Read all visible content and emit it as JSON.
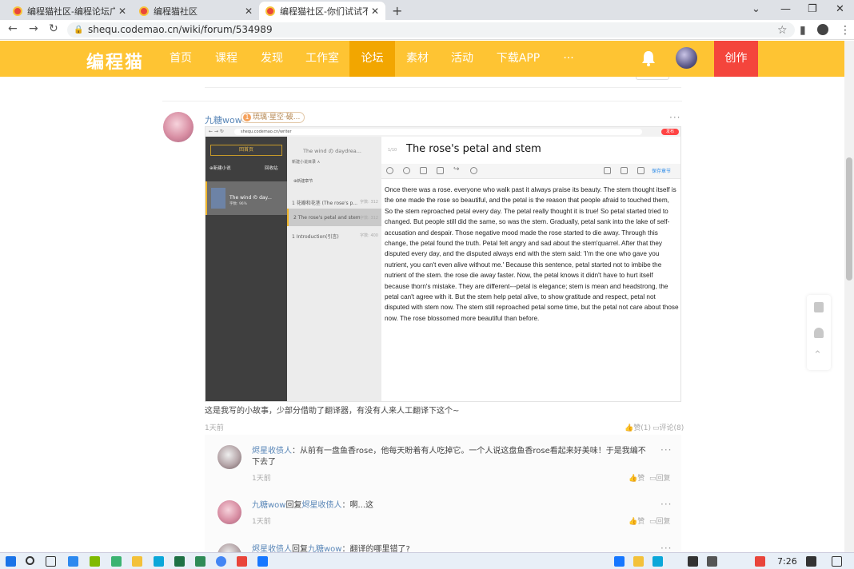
{
  "browser": {
    "tabs": [
      {
        "title": "编程猫社区-编程论坛广场-编程",
        "active": false
      },
      {
        "title": "编程猫社区",
        "active": false
      },
      {
        "title": "编程猫社区-你们试试不用任何",
        "active": true
      }
    ],
    "url": "shequ.codemao.cn/wiki/forum/534989"
  },
  "nav": {
    "logo": "编程猫",
    "items": [
      "首页",
      "课程",
      "发现",
      "工作室",
      "论坛",
      "素材",
      "活动",
      "下载APP",
      "···"
    ],
    "active_index": 4,
    "create_label": "创作",
    "accent": "#fec433",
    "create_color": "#f4453c"
  },
  "post": {
    "author": "九糖wow",
    "badge_level": "1",
    "badge_text": "琉璃·星空·破...",
    "more": "···",
    "screenshot": {
      "url": "shequ.codemao.cn/writer",
      "red_button": "发布",
      "home_button": "回首页",
      "new_novel": "⊕新建小说",
      "recycle": "回收站",
      "book_name": "The wind の day...",
      "book_sub": "字数: 96%",
      "list_header": "The wind の daydrea...",
      "list_sub": "新建小说目录 ∧",
      "list_new": "⊕新建章节",
      "chapters": [
        {
          "label": "1  花瓣和花茎 (The rose's p...",
          "words": "字数: 312",
          "selected": false
        },
        {
          "label": "2  The rose's petal and stem",
          "words": "字数: 312",
          "selected": true
        },
        {
          "label": "1  Introduction(引言)",
          "words": "字数: 400",
          "selected": false
        }
      ],
      "title": "The rose's petal and stem",
      "title_prefix": "1/10",
      "save_label": "保存章节",
      "body": "Once there was a rose. everyone who walk past it always praise its beauty. The stem thought itself is the one made the rose so beautiful, and the petal is the reason that people afraid to touched them, So the stem reproached petal every day. The petal really thought it is true! So petal started tried to changed. But people still did the same, so was the stem. Gradually, petal sank into the lake of self-accusation and despair. Those negative mood made the rose started to die away. Through this change, the petal found the truth. Petal felt angry and sad about the stem'quarrel. After that they disputed every day, and the disputed always end with the stem said: 'I'm the one who gave you nutrient, you can't even alive without me.' Because this sentence, petal started not to imbibe the nutrient of the stem. the rose die away faster. Now, the petal knows it didn't have to hurt itself because thorn's mistake. They are different---petal is elegance; stem is mean and headstrong, the petal can't agree with it. But the stem help petal alive, to show gratitude and respect, petal not disputed with stem now. The stem still reproached petal some time, but the petal not care about those now. The rose blossomed more beautiful than before."
    },
    "text": "这是我写的小故事，少部分借助了翻译器，有没有人来人工翻译下这个~",
    "time": "1天前",
    "like": "赞(1)",
    "comment": "评论(8)"
  },
  "comments": [
    {
      "name": "烬星收债人",
      "reply_word": "",
      "reply_to": "",
      "sep": "：",
      "text": "从前有一盘鱼香rose，他每天盼着有人吃掉它。一个人说这盘鱼香rose看起来好美味！于是我编不下去了",
      "time": "1天前",
      "like": "赞",
      "reply": "回复"
    },
    {
      "name": "九糖wow",
      "reply_word": "回复",
      "reply_to": "烬星收债人",
      "sep": "：",
      "text": "啊...这",
      "time": "1天前",
      "like": "赞",
      "reply": "回复"
    },
    {
      "name": "烬星收债人",
      "reply_word": "回复",
      "reply_to": "九糖wow",
      "sep": "：",
      "text": "翻译的哪里错了?",
      "time": "",
      "like": "",
      "reply": ""
    }
  ],
  "taskbar": {
    "time": "7:26"
  }
}
